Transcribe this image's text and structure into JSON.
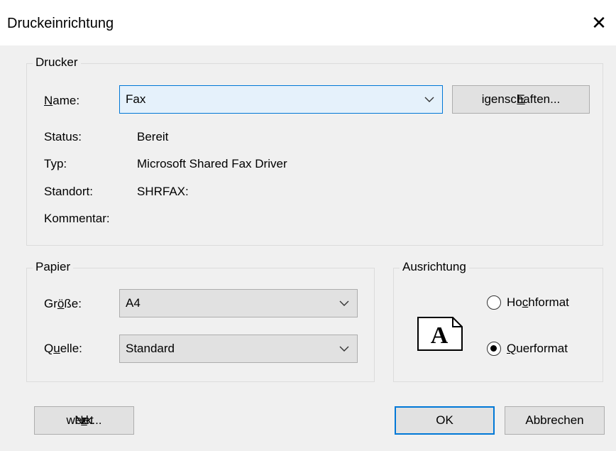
{
  "window": {
    "title": "Druckeinrichtung",
    "close_glyph": "✕"
  },
  "printer": {
    "group_label": "Drucker",
    "name_label": "Name:",
    "name_accel": "N",
    "name_rest": "ame:",
    "name_value": "Fax",
    "properties_button": "Eigenschaften...",
    "properties_accel": "E",
    "properties_rest": "igenschaften...",
    "status_label": "Status:",
    "status_value": "Bereit",
    "type_label": "Typ:",
    "type_value": "Microsoft Shared Fax Driver",
    "location_label": "Standort:",
    "location_value": "SHRFAX:",
    "comment_label": "Kommentar:",
    "comment_value": ""
  },
  "paper": {
    "group_label": "Papier",
    "size_label_pre": "Gr",
    "size_label_accel": "ö",
    "size_label_post": "ße:",
    "size_value": "A4",
    "source_label_pre": "Q",
    "source_label_accel": "u",
    "source_label_post": "elle:",
    "source_value": "Standard"
  },
  "orientation": {
    "group_label": "Ausrichtung",
    "icon_letter": "A",
    "portrait_pre": "Ho",
    "portrait_accel": "c",
    "portrait_post": "hformat",
    "portrait_selected": false,
    "landscape_pre": "",
    "landscape_accel": "Q",
    "landscape_post": "uerformat",
    "landscape_selected": true
  },
  "buttons": {
    "network_pre": "Net",
    "network_accel": "z",
    "network_post": "werk...",
    "ok": "OK",
    "cancel": "Abbrechen"
  },
  "colors": {
    "accent": "#0078d7",
    "active_field": "#e5f1fb",
    "button_face": "#e1e1e1",
    "dialog_bg": "#f0f0f0"
  }
}
